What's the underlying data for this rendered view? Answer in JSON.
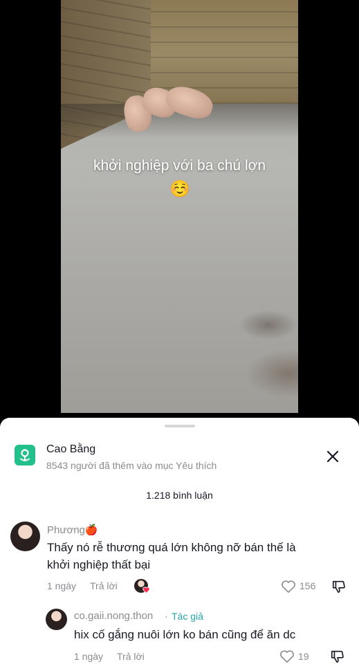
{
  "video": {
    "caption": "khởi nghiệp với ba chú lợn",
    "emoji": "☺️"
  },
  "location": {
    "title": "Cao Bằng",
    "subtitle": "8543 người đã thêm vào mục Yêu thích"
  },
  "comments_count": "1.218 bình luận",
  "comments": [
    {
      "username": "Phương🍎",
      "text_line1": "Thấy nó rễ thương quá lớn không nỡ bán thế là",
      "text_line2": "khởi nghiệp thất bại",
      "time": "1 ngày",
      "reply_label": "Trả lời",
      "likes": "156"
    }
  ],
  "reply": {
    "username": "co.gaii.nong.thon",
    "separator": "·",
    "author_tag": "Tác giả",
    "text": "hix cố gắng nuôi lớn ko bán cũng để ăn dc",
    "time": "1 ngày",
    "reply_label": "Trả lời",
    "likes": "19"
  },
  "colors": {
    "location_icon": "#22c08a",
    "author_tag": "#23a4a6",
    "secondary_text": "#8a8b91"
  }
}
